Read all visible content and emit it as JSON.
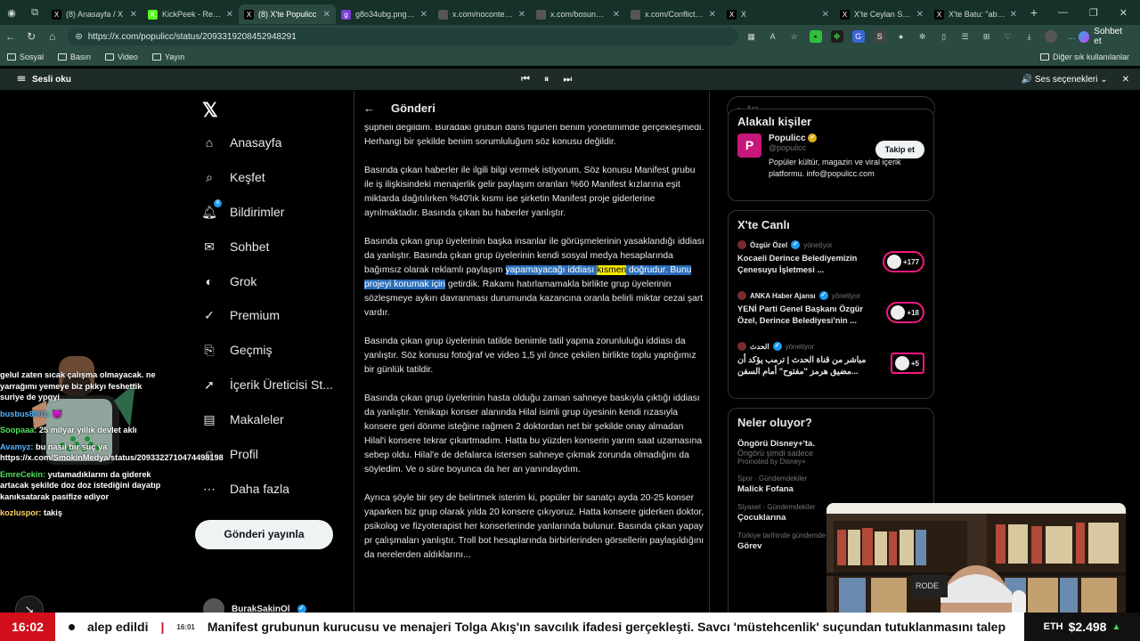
{
  "browser": {
    "tabs": [
      {
        "title": "(8) Anasayfa / X",
        "fav": "X",
        "color": "#000"
      },
      {
        "title": "KickPeek - Real-time",
        "fav": "K",
        "color": "#53fc18"
      },
      {
        "title": "(8) X'te Populicc",
        "fav": "X",
        "color": "#000"
      },
      {
        "title": "g8o34ubg.png | Ha...",
        "fav": "g",
        "color": "#7b3fd4"
      },
      {
        "title": "x.com/noconteks12...",
        "fav": "",
        "color": "#555"
      },
      {
        "title": "x.com/bosunatiklam...",
        "fav": "",
        "color": "#555"
      },
      {
        "title": "x.com/ConflictTR/st...",
        "fav": "",
        "color": "#555"
      },
      {
        "title": "X",
        "fav": "X",
        "color": "#000"
      },
      {
        "title": "X'te Ceylan Sever: \"...",
        "fav": "X",
        "color": "#000"
      },
      {
        "title": "X'te Batu: \"abisinin ...",
        "fav": "X",
        "color": "#000"
      }
    ],
    "url": "https://x.com/populicc/status/2093319208452948291",
    "profile_label": "Sohbet et",
    "bookmarks": [
      "Sosyal",
      "Basın",
      "Video",
      "Yayın"
    ],
    "other_bookmarks": "Diğer sık kullanılanlar",
    "read_aloud": "Sesli oku",
    "voice_options": "Ses seçenekleri"
  },
  "nav": {
    "items": [
      {
        "label": "Anasayfa",
        "icon": "home-icon"
      },
      {
        "label": "Keşfet",
        "icon": "search-icon"
      },
      {
        "label": "Bildirimler",
        "icon": "bell-icon"
      },
      {
        "label": "Sohbet",
        "icon": "chat-icon"
      },
      {
        "label": "Grok",
        "icon": "grok-icon"
      },
      {
        "label": "Premium",
        "icon": "premium-icon"
      },
      {
        "label": "Geçmiş",
        "icon": "bookmark-icon"
      },
      {
        "label": "İçerik Üreticisi St...",
        "icon": "creator-icon"
      },
      {
        "label": "Makaleler",
        "icon": "article-icon"
      },
      {
        "label": "Profil",
        "icon": "profile-icon"
      },
      {
        "label": "Daha fazla",
        "icon": "more-icon"
      }
    ],
    "post_button": "Gönderi yayınla",
    "account_name": "BurakSakinOl"
  },
  "main": {
    "header": "Gönderi",
    "p1": "şüpheli değildim. Buradaki grubun dans figürleri benim yönetimimde gerçekleşmedi. Herhangi bir şekilde benim sorumluluğum söz konusu değildir.",
    "p2": "Basında çıkan haberler ile ilgili bilgi vermek istiyorum. Söz konusu Manifest grubu ile iş ilişkisindeki menajerlik gelir paylaşım oranları %60 Manifest kızlarına eşit miktarda dağıtılırken %40'lık kısmı ise şirketin Manifest proje giderlerine ayrılmaktadır. Basında çıkan bu haberler yanlıştır.",
    "p3a": "Basında çıkan grup üyelerinin başka insanlar ile görüşmelerinin yasaklandığı iddiası da yanlıştır. Basında çıkan grup üyelerinin kendi sosyal medya hesaplarında bağımsız olarak reklamlı paylaşım ",
    "p3_hl1": "yapamayacağı iddiası ",
    "p3_hl2": "kısmen",
    "p3_hl3": " doğrudur. Bunu projeyi korumak için",
    "p3b": " getirdik. Rakamı hatırlamamakla birlikte grup üyelerinin sözleşmeye aykırı davranması durumunda kazancına oranla belirli miktar cezai şart vardır.",
    "p4": "Basında çıkan grup üyelerinin tatilde benimle tatil yapma zorunluluğu iddiası da yanlıştır. Söz konusu fotoğraf ve video 1,5 yıl önce çekilen birlikte toplu yaptığımız bir günlük tatildir.",
    "p5": "Basında çıkan grup üyelerinin hasta olduğu zaman sahneye baskıyla çıktığı iddiası da yanlıştır. Yenikapı konser alanında Hilal isimli grup üyesinin kendi rızasıyla konsere geri dönme isteğine rağmen 2 doktordan net bir şekilde onay almadan Hilal'i konsere tekrar çıkartmadım. Hatta bu yüzden konserin yarım saat uzamasına sebep oldu. Hilal'e de defalarca istersen sahneye çıkmak zorunda olmadığını da söyledim. Ve o süre boyunca da her an yanındaydım.",
    "p6": "Ayrıca şöyle bir şey de belirtmek isterim ki, popüler bir sanatçı ayda 20-25 konser yaparken biz grup olarak yılda 20 konsere çıkıyoruz. Hatta konsere giderken doktor, psikolog ve fizyoterapist her konserlerinde yanlarında bulunur. Basında çıkan yapay pr çalışmaları yanlıştır. Troll bot hesaplarında birbirlerinden görsellerin paylaşıldığını da nerelerden aldıklarını..."
  },
  "right": {
    "search_placeholder": "Ara",
    "related_title": "Alakalı kişiler",
    "account": {
      "name": "Populicc",
      "handle": "@populicc",
      "bio": "Popüler kültür, magazin ve viral içerik platformu. info@populicc.com",
      "follow": "Takip et",
      "avatar": "P"
    },
    "live_title": "X'te Canlı",
    "live": [
      {
        "source": "Özgür Özel",
        "status": "yönetiyor",
        "text": "Kocaeli Derince Belediyemizin Çenesuyu İşletmesi ...",
        "count": "+177"
      },
      {
        "source": "ANKA Haber Ajansı",
        "status": "yönetiyor",
        "text": "YENİ Parti Genel Başkanı Özgür Özel, Derince Belediyesi'nin ...",
        "count": "+18"
      },
      {
        "source": "الحدث",
        "status": "yönetiyor",
        "text": "مباشر من قناة الحدث | ترمب يؤكد أن مضيق هرمز \"مفتوح\" أمام السفن...",
        "count": "+5"
      }
    ],
    "trends_title": "Neler oluyor?",
    "trends": [
      {
        "category": "",
        "title": "Öngörü Disney+'ta.",
        "sub": "Öngörü şimdi sadece",
        "promo": "Promoted by Disney+"
      },
      {
        "category": "Spor · Gündemdekiler",
        "title": "Malick Fofana"
      },
      {
        "category": "Siyaset · Gündemdekiler",
        "title": "Çocuklarına"
      },
      {
        "category": "Türkiye tarihinde gündemde",
        "title": "Görev"
      }
    ]
  },
  "stream_chat": [
    {
      "user": "",
      "text": "gelul zaten sıcak çalışma olmayacak. ne yarrağımı yemeye biz pkkyı feshettik suriye de ypgyi"
    },
    {
      "user": "busbus8901:",
      "text": "👿"
    },
    {
      "user": "Soopaaa:",
      "text": "25 milyar yıllık devlet aklı"
    },
    {
      "user": "Avamyz:",
      "text": "bu nasıl bir suç ya https://x.com/SmokinMedya/status/2093322710474498198"
    },
    {
      "user": "EmreCekin:",
      "text": "yutamadıklarını da giderek artacak şekilde doz doz istediğini dayatıp kanıksatarak pasifize ediyor"
    },
    {
      "user": "kozluspor:",
      "text": "takiş"
    }
  ],
  "ticker": {
    "clock": "16:02",
    "news_prefix": "alep edildi",
    "news_time": "16:01",
    "news": "Manifest grubunun kurucusu ve menajeri Tolga Akış'ın savcılık ifadesi gerçekleşti. Savcı 'müstehcenlik' suçundan tutuklanmasını talep",
    "eth_label": "ETH",
    "eth_value": "$2.498"
  }
}
